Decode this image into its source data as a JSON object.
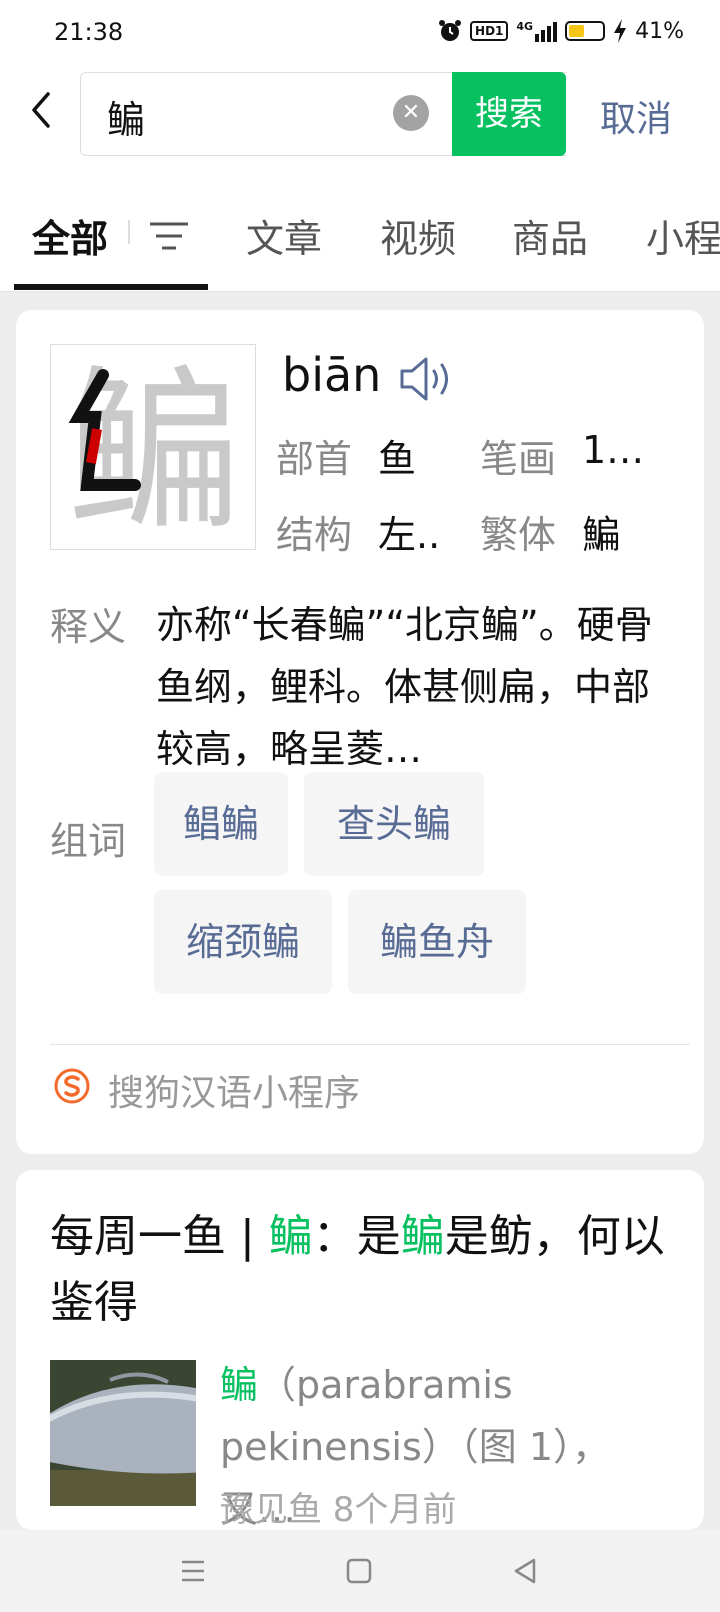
{
  "status_bar": {
    "time": "21:38",
    "hd_label": "HD1",
    "network_label": "4G",
    "battery_percent": "41%",
    "battery_level": 0.41,
    "icons": [
      "alarm-icon",
      "hd-icon",
      "signal-icon",
      "battery-icon",
      "charging-icon"
    ]
  },
  "search": {
    "query": "鳊",
    "search_button": "搜索",
    "cancel": "取消",
    "accent_color": "#07c160",
    "link_color": "#576b95"
  },
  "tabs": [
    {
      "label": "全部",
      "active": true
    },
    {
      "label": "文章",
      "active": false
    },
    {
      "label": "视频",
      "active": false
    },
    {
      "label": "商品",
      "active": false
    },
    {
      "label": "小程序",
      "active": false
    }
  ],
  "dictionary_card": {
    "character": "鳊",
    "pinyin": "biān",
    "radical_label": "部首",
    "radical_value": "鱼",
    "strokes_label": "笔画",
    "strokes_value": "1…",
    "structure_label": "结构",
    "structure_value": "左..",
    "traditional_label": "繁体",
    "traditional_value": "鯿",
    "definition_label": "释义",
    "definition_text": "亦称“长春鳊”“北京鳊”。硬骨鱼纲，鲤科。体甚侧扁，中部较高，略呈菱…",
    "words_label": "组词",
    "words": [
      "鲳鳊",
      "查头鳊",
      "缩颈鳊",
      "鳊鱼舟"
    ],
    "source": "搜狗汉语小程序"
  },
  "article_card": {
    "title_before": "每周一鱼 | ",
    "title_hl1": "鳊",
    "title_middle": "：是",
    "title_hl2": "鳊",
    "title_after": "是鲂，何以鉴得",
    "snippet_hl": "鳊",
    "snippet_rest": "（parabramis pekinensis）（图 1），又…",
    "meta": "豫见鱼 8个月前"
  },
  "nav_bar": {
    "icons": [
      "menu-icon",
      "home-icon",
      "back-triangle-icon"
    ]
  }
}
